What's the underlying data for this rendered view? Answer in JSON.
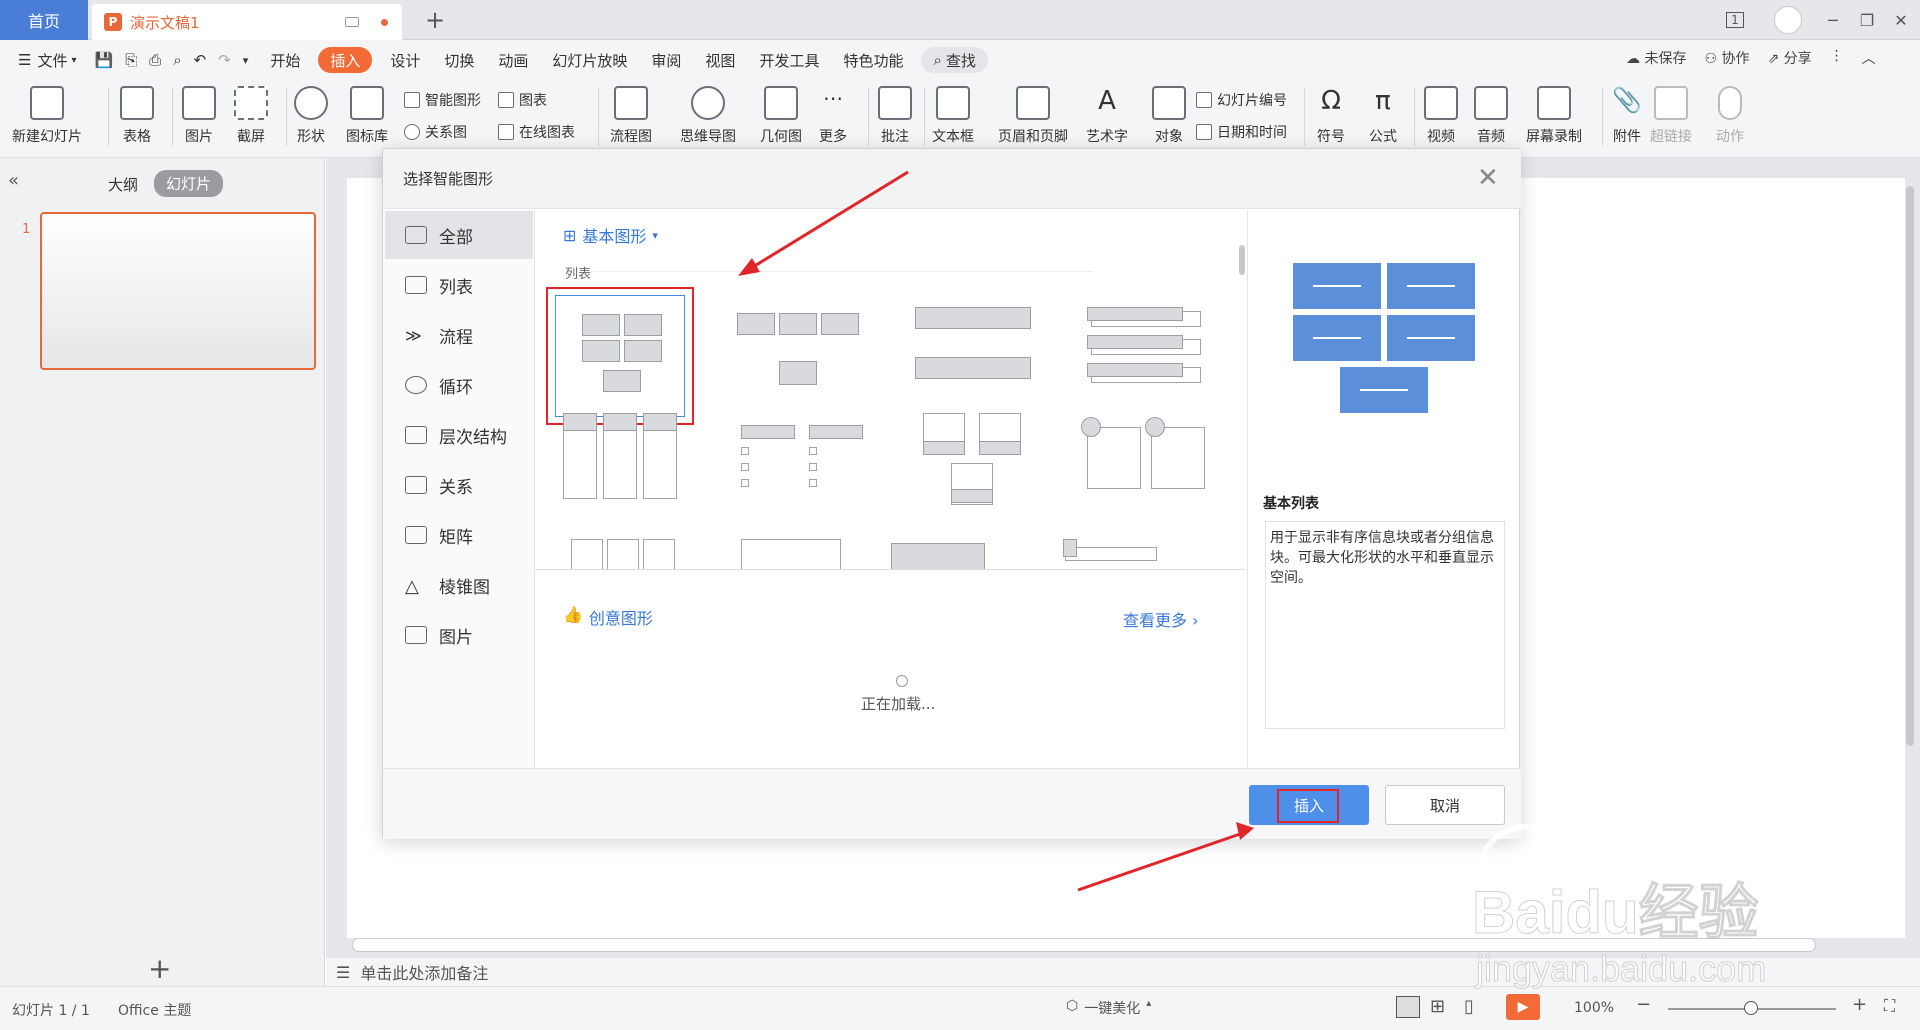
{
  "tabs": {
    "home": "首页",
    "doc_title": "演示文稿1"
  },
  "menu": {
    "file": "文件",
    "items": [
      "开始",
      "插入",
      "设计",
      "切换",
      "动画",
      "幻灯片放映",
      "审阅",
      "视图",
      "开发工具",
      "特色功能"
    ],
    "active": "插入",
    "search": "查找",
    "right": [
      "未保存",
      "协作",
      "分享"
    ]
  },
  "ribbon": {
    "new_slide": "新建幻灯片",
    "table": "表格",
    "picture": "图片",
    "screenshot": "截屏",
    "shape": "形状",
    "icon_lib": "图标库",
    "smart_art": "智能图形",
    "chart": "图表",
    "relation_chart": "关系图",
    "online_chart": "在线图表",
    "flowchart": "流程图",
    "mindmap": "思维导图",
    "geometry": "几何图",
    "more": "更多",
    "comment": "批注",
    "textbox": "文本框",
    "header_footer": "页眉和页脚",
    "wordart": "艺术字",
    "object": "对象",
    "slide_number": "幻灯片编号",
    "datetime": "日期和时间",
    "symbol": "符号",
    "formula": "公式",
    "video": "视频",
    "audio": "音频",
    "screen_record": "屏幕录制",
    "attachment": "附件",
    "hyperlink": "超链接",
    "action": "动作"
  },
  "left_panel": {
    "outline": "大纲",
    "slides": "幻灯片",
    "slide_num": "1"
  },
  "notes": {
    "placeholder": "单击此处添加备注"
  },
  "dialog": {
    "title": "选择智能图形",
    "categories": [
      "全部",
      "列表",
      "流程",
      "循环",
      "层次结构",
      "关系",
      "矩阵",
      "棱锥图",
      "图片"
    ],
    "section_title": "基本图形",
    "subsection": "列表",
    "creative_title": "创意图形",
    "see_more": "查看更多",
    "loading": "正在加载...",
    "preview_name": "基本列表",
    "preview_desc": "用于显示非有序信息块或者分组信息块。可最大化形状的水平和垂直显示空间。",
    "insert": "插入",
    "cancel": "取消"
  },
  "status": {
    "slide_info": "幻灯片 1 / 1",
    "theme": "Office 主题",
    "beautify": "一键美化",
    "zoom": "100%"
  },
  "watermark": {
    "brand": "Baidu经验",
    "url": "jingyan.baidu.com"
  }
}
